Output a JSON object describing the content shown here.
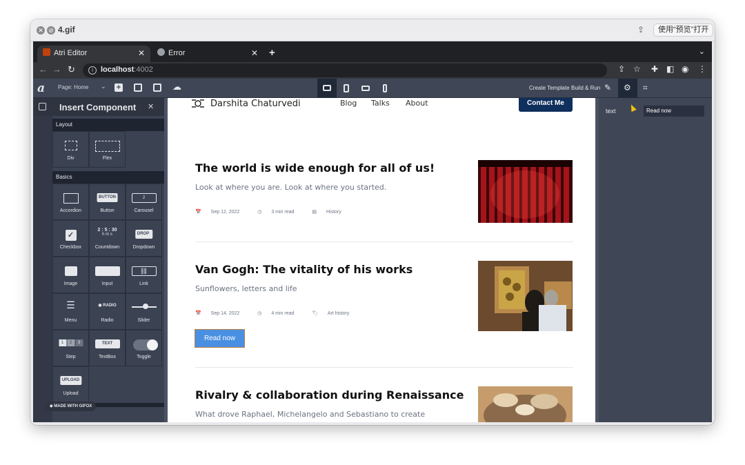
{
  "mac": {
    "file_title": "4.gif",
    "open_with": "使用“预览”打开"
  },
  "browser": {
    "tabs": [
      {
        "label": "Atri Editor",
        "active": true
      },
      {
        "label": "Error",
        "active": false
      }
    ],
    "url_host": "localhost",
    "url_port": ":4002"
  },
  "editor": {
    "page_select": "Page: Home",
    "create_template": "Create Template",
    "build_run": "Build & Run"
  },
  "insert_panel": {
    "title": "Insert Component",
    "sections": [
      {
        "name": "Layout",
        "components": [
          "Div",
          "Flex"
        ]
      },
      {
        "name": "Basics",
        "components": [
          "Accordion",
          "Button",
          "Carousel",
          "Checkbox",
          "Countdown",
          "Dropdown",
          "Image",
          "Input",
          "Link",
          "Menu",
          "Radio",
          "Slider",
          "Step",
          "TextBox",
          "Toggle",
          "Upload"
        ]
      }
    ],
    "preview_text": {
      "button": "BUTTON",
      "carousel": "2",
      "countdown_digits": "2 : 5 : 30",
      "countdown_units": "h  m  s",
      "dropdown": "DROP",
      "radio": "RADIO",
      "step": [
        "1",
        "2",
        "3"
      ],
      "textbox": "TEXT",
      "upload": "UPLOAD"
    },
    "badge": "MADE WITH GIFOX"
  },
  "site": {
    "name": "Darshita Chaturvedi",
    "nav": [
      "Blog",
      "Talks",
      "About"
    ],
    "contact": "Contact Me",
    "read_now": "Read now",
    "posts": [
      {
        "title": "The world is wide enough for all of us!",
        "subtitle": "Look at where you are. Look at where you started.",
        "date": "Sep 12, 2022",
        "read_time": "3 min read",
        "tag": "History"
      },
      {
        "title": "Van Gogh: The vitality of his works",
        "subtitle": "Sunflowers, letters and life",
        "date": "Sep 14, 2022",
        "read_time": "4 min read",
        "tag": "Art history"
      },
      {
        "title": "Rivalry & collaboration during Renaissance",
        "subtitle": "What drove Raphael, Michelangelo and Sebastiano to create"
      }
    ]
  },
  "props_panel": {
    "label": "text",
    "value": "Read now"
  }
}
